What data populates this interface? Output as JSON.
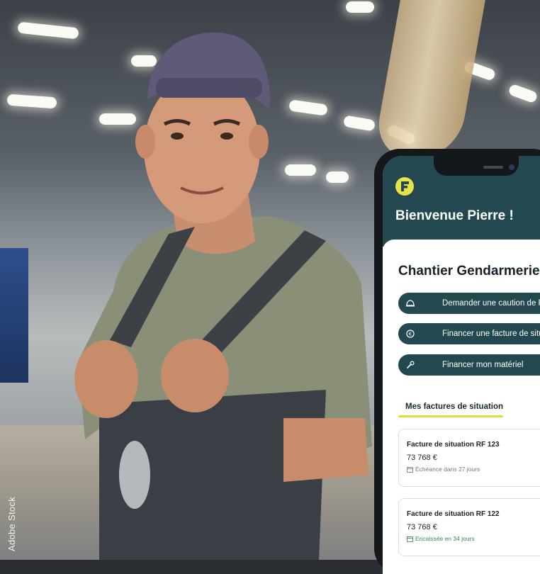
{
  "watermark": "Adobe Stock",
  "app": {
    "greeting": "Bienvenue Pierre !",
    "project_title": "Chantier Gendarmerie",
    "actions": [
      {
        "label": "Demander une caution de R",
        "icon": "helmet-icon"
      },
      {
        "label": "Financer une facture de situat",
        "icon": "euro-icon"
      },
      {
        "label": "Financer mon matériel",
        "icon": "wrench-icon"
      }
    ],
    "section_title": "Mes factures de situation",
    "invoices": [
      {
        "title": "Facture de situation RF 123",
        "amount": "73 768 €",
        "status": "Échéance dans 27 jours",
        "status_color": "#6f7a80"
      },
      {
        "title": "Facture de situation RF 122",
        "amount": "73 768 €",
        "status": "Encaissée en 34 jours",
        "status_color": "#3a8a52"
      }
    ],
    "colors": {
      "header": "#23484f",
      "accent": "#dede3e",
      "button": "#23484f"
    }
  }
}
